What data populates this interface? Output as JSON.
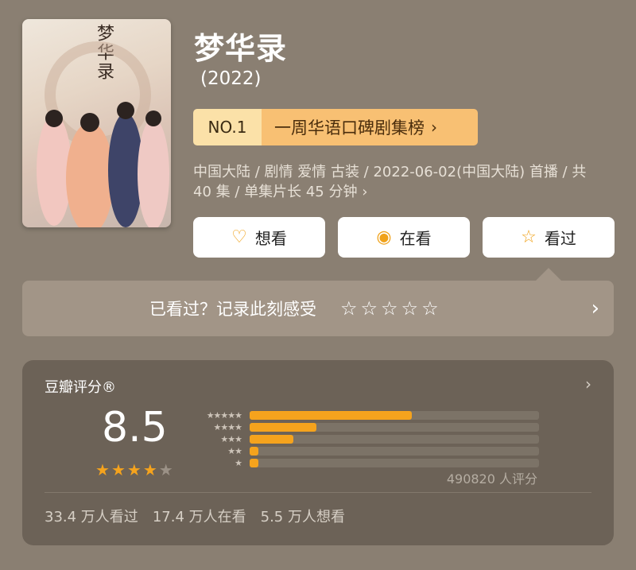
{
  "title": "梦华录",
  "year": "(2022)",
  "poster": {
    "art_title": "梦华录"
  },
  "rank": {
    "number": "NO.1",
    "text": "一周华语口碑剧集榜",
    "chevron": "›"
  },
  "meta": "中国大陆 / 剧情 爱情 古装 / 2022-06-02(中国大陆) 首播 / 共 40 集 / 单集片长 45 分钟 ›",
  "actions": [
    {
      "label": "想看",
      "icon": "heart-plus-icon",
      "glyph": "♡"
    },
    {
      "label": "在看",
      "icon": "target-icon",
      "glyph": "◉"
    },
    {
      "label": "看过",
      "icon": "star-icon",
      "glyph": "☆"
    }
  ],
  "record": {
    "prompt": "已看过？记录此刻感受",
    "stars": [
      "☆",
      "☆",
      "☆",
      "☆",
      "☆"
    ],
    "chevron": "›"
  },
  "rating": {
    "label": "豆瓣评分®",
    "chevron": "›",
    "score": "8.5",
    "stars_filled": 4,
    "stars_total": 5,
    "star_labels": [
      "★★★★★",
      "★★★★",
      "★★★",
      "★★",
      "★"
    ],
    "distribution": [
      0.56,
      0.23,
      0.15,
      0.03,
      0.03
    ],
    "count": "490820 人评分",
    "stats": [
      "33.4 万人看过",
      "17.4 万人在看",
      "5.5 万人想看"
    ]
  },
  "colors": {
    "accent": "#f5a31d",
    "background": "#8a7f72",
    "card": "#6c6257"
  }
}
